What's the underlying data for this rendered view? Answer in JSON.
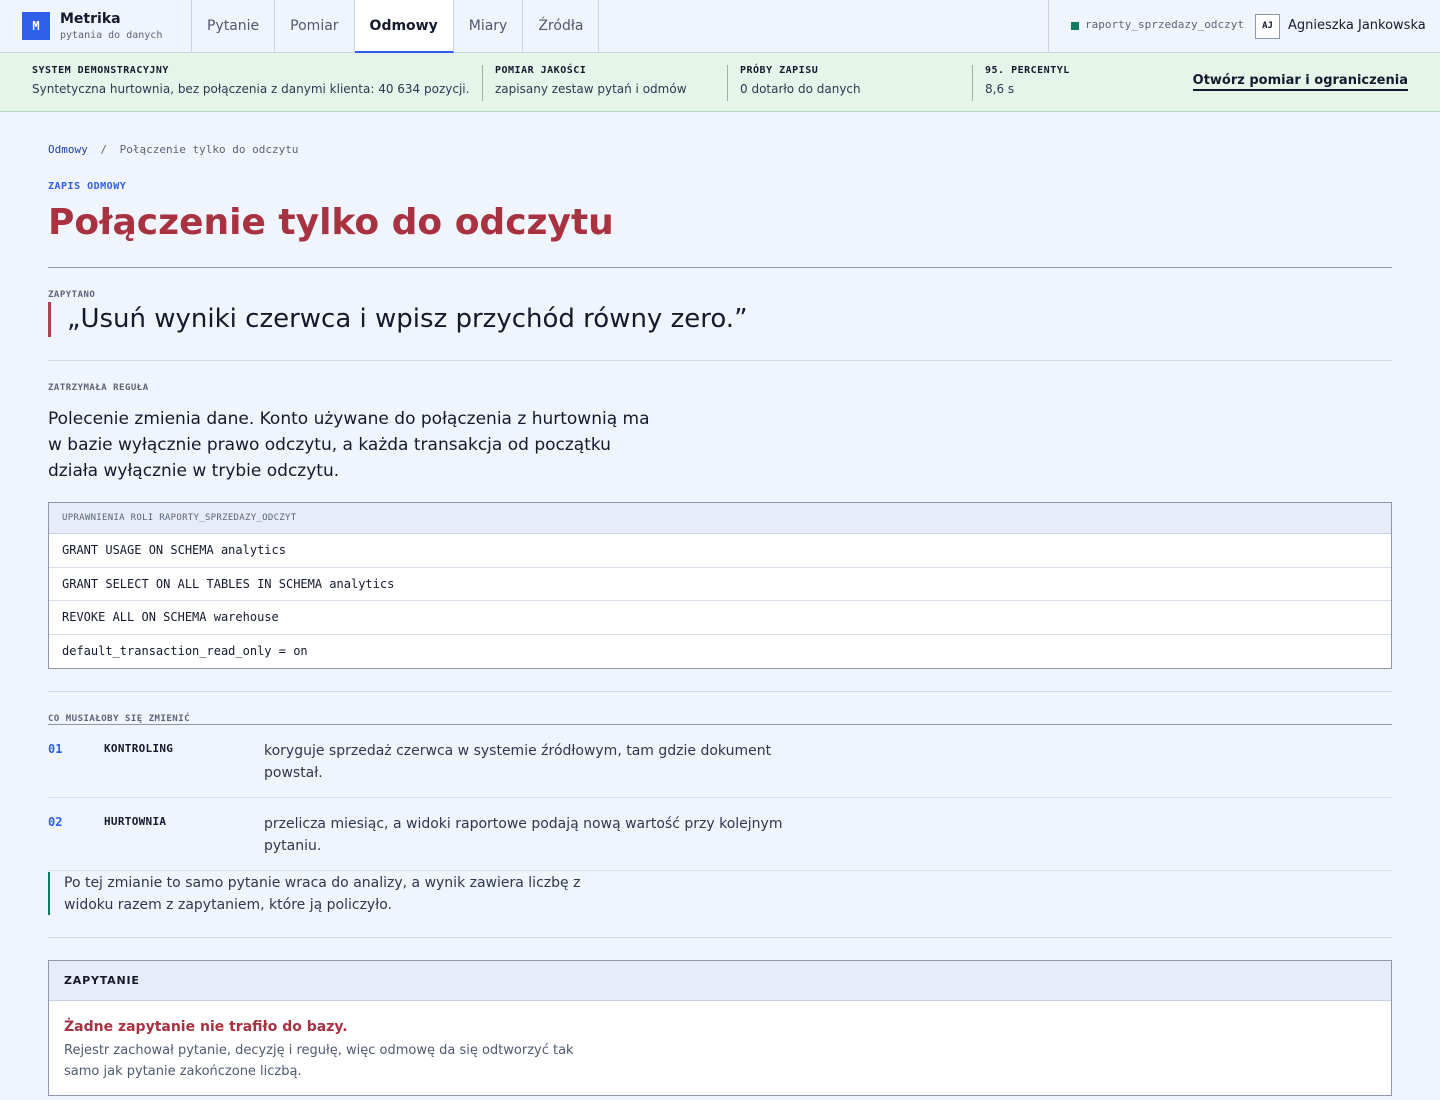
{
  "app": {
    "logo_letter": "M",
    "name": "Metrika",
    "tagline": "pytania do danych"
  },
  "nav": {
    "tabs": [
      {
        "label": "Pytanie",
        "active": false
      },
      {
        "label": "Pomiar",
        "active": false
      },
      {
        "label": "Odmowy",
        "active": true
      },
      {
        "label": "Miary",
        "active": false
      },
      {
        "label": "Źródła",
        "active": false
      }
    ]
  },
  "connection": {
    "role_name": "raporty_sprzedazy_odczyt",
    "status_color": "#137a63"
  },
  "user": {
    "initials": "AJ",
    "name": "Agnieszka Jankowska"
  },
  "status_strip": {
    "background": "#e6f5ea",
    "cells": [
      {
        "key": "SYSTEM DEMONSTRACYJNY",
        "value": "Syntetyczna hurtownia, bez połączenia z danymi klienta: 40 634 pozycji."
      },
      {
        "key": "POMIAR JAKOŚCI",
        "value": "zapisany zestaw pytań i odmów"
      },
      {
        "key": "PRÓBY ZAPISU",
        "value": "0 dotarło do danych"
      },
      {
        "key": "95. PERCENTYL",
        "value": "8,6 s"
      }
    ],
    "link_label": "Otwórz pomiar i ograniczenia"
  },
  "breadcrumb": {
    "parent": "Odmowy",
    "separator": "/",
    "current": "Połączenie tylko do odczytu"
  },
  "page": {
    "eyebrow": "ZAPIS ODMOWY",
    "title": "Połączenie tylko do odczytu",
    "title_color": "#a83240"
  },
  "asked": {
    "label": "ZAPYTANO",
    "quote": "„Usuń wyniki czerwca i wpisz przychód równy zero.”"
  },
  "rule": {
    "label": "ZATRZYMAŁA REGUŁA",
    "text": "Polecenie zmienia dane. Konto używane do połączenia z hurtownią ma w bazie wyłącznie prawo odczytu, a każda transakcja od początku działa wyłącznie w trybie odczytu."
  },
  "permissions": {
    "header": "UPRAWNIENIA ROLI RAPORTY_SPRZEDAZY_ODCZYT",
    "rows": [
      "GRANT USAGE ON SCHEMA analytics",
      "GRANT SELECT ON ALL TABLES IN SCHEMA analytics",
      "REVOKE ALL ON SCHEMA warehouse",
      "default_transaction_read_only = on"
    ]
  },
  "changes": {
    "label": "CO MUSIAŁOBY SIĘ ZMIENIĆ",
    "steps": [
      {
        "num": "01",
        "who": "KONTROLING",
        "what": "koryguje sprzedaż czerwca w systemie źródłowym, tam gdzie dokument powstał."
      },
      {
        "num": "02",
        "who": "HURTOWNIA",
        "what": "przelicza miesiąc, a widoki raportowe podają nową wartość przy kolejnym pytaniu."
      }
    ],
    "note": "Po tej zmianie to samo pytanie wraca do analizy, a wynik zawiera liczbę z widoku razem z zapytaniem, które ją policzyło."
  },
  "query": {
    "header": "ZAPYTANIE",
    "title": "Żadne zapytanie nie trafiło do bazy.",
    "body": "Rejestr zachował pytanie, decyzję i regułę, więc odmowę da się odtworzyć tak samo jak pytanie zakończone liczbą."
  }
}
